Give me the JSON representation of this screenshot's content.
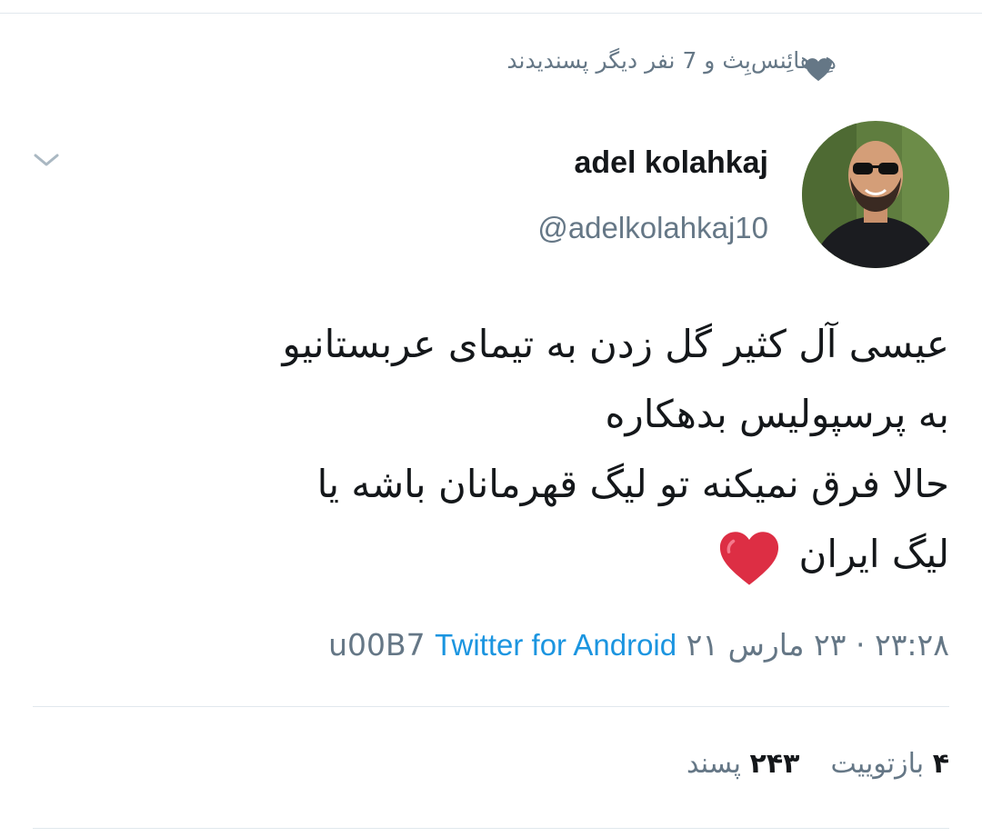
{
  "social_context": {
    "text": "هِرهائِنس‌بِث و 7 نفر دیگر پسندیدند",
    "icon": "heart-icon"
  },
  "author": {
    "display_name": "adel kolahkaj",
    "handle": "@adelkolahkaj10",
    "avatar_icon": "avatar-photo"
  },
  "tweet": {
    "lines": [
      "عیسی آل کثیر گل زدن به تیمای عربستانیو",
      "به پرسپولیس بدهکاره",
      "حالا فرق نمیکنه تو لیگ قهرمانان باشه یا",
      "لیگ ایران"
    ],
    "emoji_icon": "red-heart-emoji"
  },
  "meta": {
    "time": "۲۳:۲۸",
    "separator": "·",
    "date": "۲۳ مارس ۲۱",
    "dot_text": "u00B7",
    "source": "Twitter for Android"
  },
  "stats": {
    "retweets_count": "۴",
    "retweets_label": "بازتوییت",
    "likes_count": "۲۴۳",
    "likes_label": "پسند"
  },
  "colors": {
    "text_primary": "#14171a",
    "text_secondary": "#657786",
    "link": "#1b95e0",
    "divider": "#e1e8ed",
    "heart_gray": "#657786",
    "heart_red": "#e0245e"
  }
}
